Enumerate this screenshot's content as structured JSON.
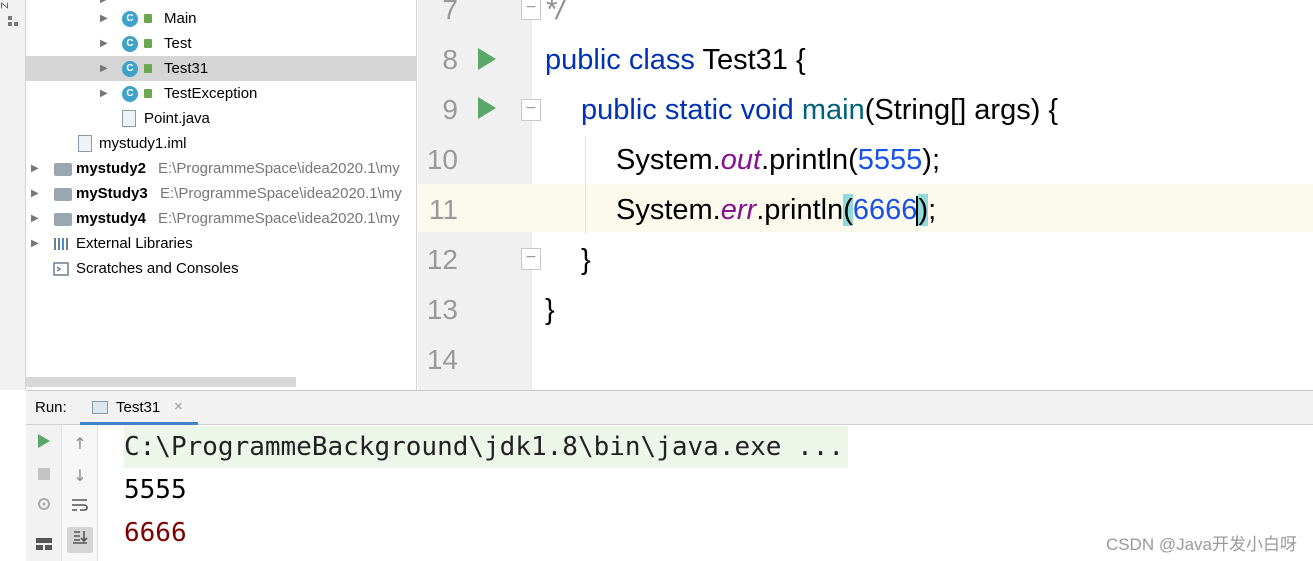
{
  "tool_strip": {
    "label": "Z"
  },
  "project_tree": {
    "classes": [
      {
        "name": "Main"
      },
      {
        "name": "Test"
      },
      {
        "name": "Test31",
        "selected": true
      },
      {
        "name": "TestException"
      }
    ],
    "point_file": "Point.java",
    "iml_file": "mystudy1.iml",
    "modules": [
      {
        "name": "mystudy2",
        "path": "E:\\ProgrammeSpace\\idea2020.1\\my"
      },
      {
        "name": "myStudy3",
        "path": "E:\\ProgrammeSpace\\idea2020.1\\my"
      },
      {
        "name": "mystudy4",
        "path": "E:\\ProgrammeSpace\\idea2020.1\\my"
      }
    ],
    "external_libraries": "External Libraries",
    "scratches": "Scratches and Consoles"
  },
  "editor": {
    "line_numbers": [
      "7",
      "8",
      "9",
      "10",
      "11",
      "12",
      "13",
      "14"
    ],
    "line7": {
      "comment": "*/"
    },
    "line8": {
      "kw1": "public",
      "kw2": "class",
      "name": "Test31",
      "brace": "{"
    },
    "line9": {
      "kw1": "public",
      "kw2": "static",
      "kw3": "void",
      "method": "main",
      "params": "(String[] args) {"
    },
    "line10": {
      "obj": "System.",
      "field": "out",
      "call": ".println(",
      "num": "5555",
      "end": ");"
    },
    "line11": {
      "obj": "System.",
      "field": "err",
      "call": ".println",
      "open": "(",
      "num": "6666",
      "close": ")",
      "end": ";"
    },
    "line12": {
      "brace": "}"
    },
    "line13": {
      "brace": "}"
    }
  },
  "run_panel": {
    "label": "Run:",
    "tab_name": "Test31",
    "tab_close": "×",
    "command": "C:\\ProgrammeBackground\\jdk1.8\\bin\\java.exe ...",
    "stdout": "5555",
    "stderr": "6666"
  },
  "watermark": "CSDN @Java开发小白呀",
  "colors": {
    "keyword": "#0033b3",
    "number": "#1750eb",
    "static_field": "#871094",
    "stderr": "#7f0000",
    "run_green": "#59a869",
    "selection": "#d5d5d5"
  }
}
